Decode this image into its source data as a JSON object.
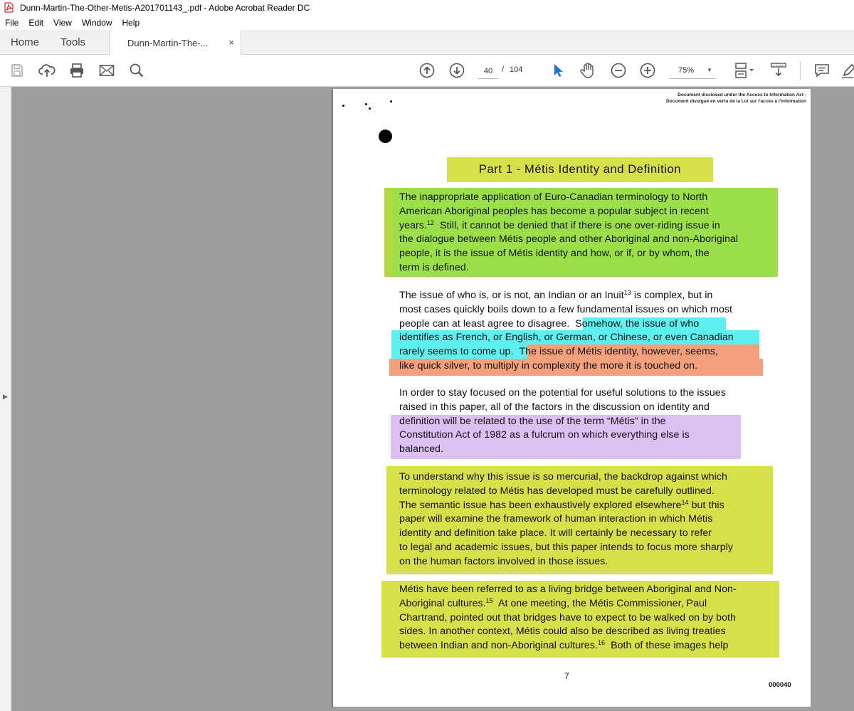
{
  "window": {
    "title": "Dunn-Martin-The-Other-Metis-A201701143_.pdf - Adobe Acrobat Reader DC"
  },
  "menu": [
    "File",
    "Edit",
    "View",
    "Window",
    "Help"
  ],
  "tabs": {
    "home": "Home",
    "tools": "Tools",
    "document": "Dunn-Martin-The-...",
    "close": "×"
  },
  "toolbar": {
    "current_page": "40",
    "page_sep": "/",
    "total_pages": "104",
    "zoom": "75%",
    "icons": [
      "save-icon",
      "upload-icon",
      "print-icon",
      "email-icon",
      "search-icon",
      "prev-page-icon",
      "next-page-icon",
      "select-cursor-icon",
      "hand-tool-icon",
      "zoom-out-icon",
      "zoom-in-icon",
      "page-layout-icon",
      "scroll-mode-icon",
      "comment-icon",
      "pen-icon"
    ]
  },
  "document": {
    "disclosure_line1": "Document disclosed under the Access to Information Act -",
    "disclosure_line2": "Document divulgué en vertu de la Loi sur l'accès à l'information",
    "heading": "Part 1 - Métis Identity and Definition",
    "p1": [
      "The inappropriate application of Euro-Canadian terminology to North",
      "American Aboriginal peoples has become a popular subject in recent",
      "years.",
      "12",
      "  Still, it cannot be denied that if there is one over-riding issue in",
      "the dialogue between Métis people and other Aboriginal and non-Aboriginal",
      "people, it is the issue of Métis identity and how, or if, or by whom, the",
      "term is defined."
    ],
    "p2": [
      "The issue of who is, or is not, an Indian or an Inuit",
      "13",
      " is complex, but in",
      "most cases quickly boils down to a few fundamental issues on which most",
      "people can at least agree to disagree.",
      "Somehow, the issue of who",
      "identifies as French, or English, or German, or Chinese, or even Canadian",
      "rarely seems to come up.",
      "The issue of Métis identity, however, seems,",
      "like quick silver, to multiply in complexity the more it is touched on."
    ],
    "p3": [
      "In order to stay focused on the potential for useful solutions to the issues",
      "raised in this paper, all of the factors in the discussion on identity and",
      "definition will be related to the use of the term “Métis” in the",
      "Constitution Act of 1982 as a fulcrum on which everything else is",
      "balanced."
    ],
    "p4": [
      "To understand why this issue is so mercurial, the backdrop against which",
      "terminology related to Métis has developed must be carefully outlined.",
      "The semantic issue has been exhaustively explored elsewhere",
      "14",
      " but this",
      "paper will examine the framework of human interaction in which Métis",
      "identity and definition take place.  It will certainly be necessary to refer",
      "to legal and academic issues, but this paper intends to focus more sharply",
      "on the human factors involved in those issues."
    ],
    "p5": [
      "Métis have been referred to as a living bridge between Aboriginal and Non-",
      "Aboriginal cultures.",
      "15",
      "  At one meeting, the Métis Commissioner, Paul",
      "Chartrand, pointed out that bridges have to expect to be walked on by both",
      "sides.  In another context, Métis could also be described as living treaties",
      "between Indian and non-Aboriginal cultures.",
      "16",
      "  Both of these images help"
    ],
    "page_number": "7",
    "doc_code": "000040"
  },
  "colors": {
    "heading_highlight": "#d6e04a",
    "green_highlight": "#9be04a",
    "cyan_highlight": "#5ef0f0",
    "salmon_highlight": "#f4a07c",
    "lavender_highlight": "#dcc0f4",
    "yellow_highlight": "#d6e04a"
  }
}
